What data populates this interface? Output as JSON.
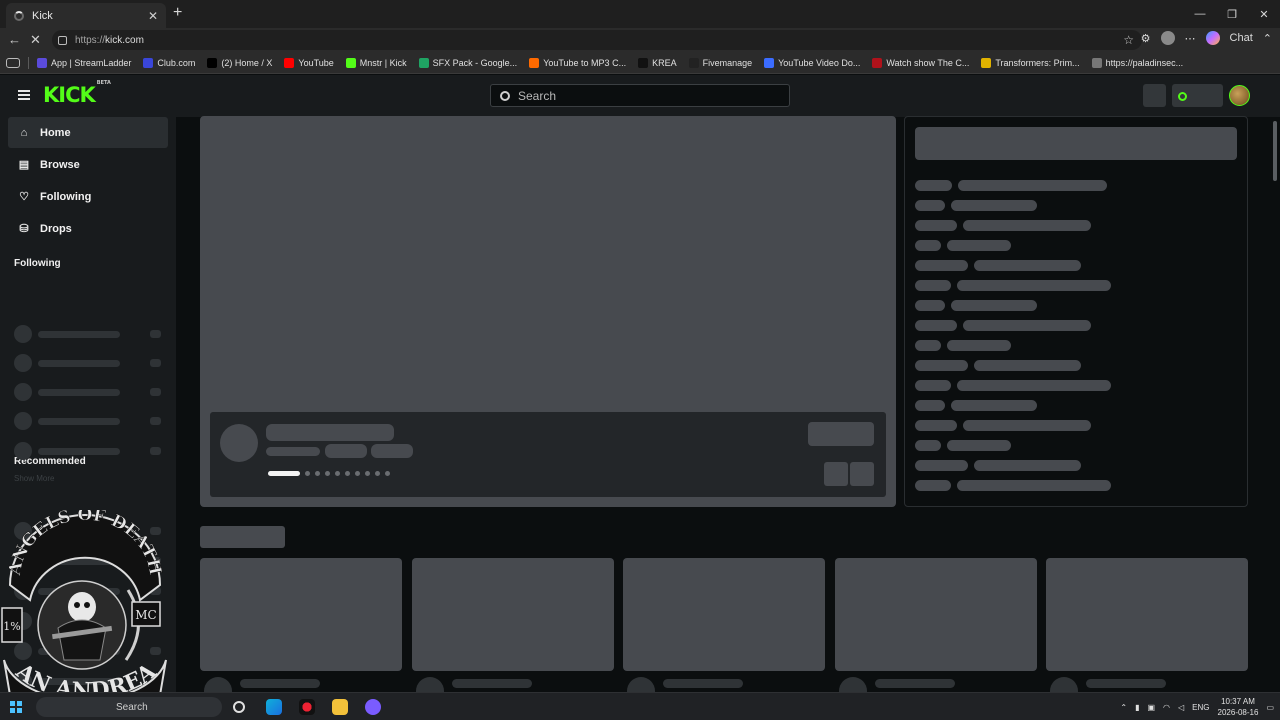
{
  "browser": {
    "tab_title": "Kick",
    "new_tab_glyph": "+",
    "url_protocol": "https://",
    "url_host": "kick.com",
    "chat_label": "Chat",
    "bookmarks": [
      {
        "label": "App | StreamLadder",
        "color": "#5b4bdb"
      },
      {
        "label": "Club.com",
        "color": "#3a46d9"
      },
      {
        "label": "(2) Home / X",
        "color": "#000000"
      },
      {
        "label": "YouTube",
        "color": "#ff0000"
      },
      {
        "label": "Mnstr | Kick",
        "color": "#53fc18"
      },
      {
        "label": "SFX Pack - Google...",
        "color": "#1fa463"
      },
      {
        "label": "YouTube to MP3 C...",
        "color": "#ff6a00"
      },
      {
        "label": "KREA",
        "color": "#111111"
      },
      {
        "label": "Fivemanage",
        "color": "#222222"
      },
      {
        "label": "YouTube Video Do...",
        "color": "#3b6cff"
      },
      {
        "label": "Watch show The C...",
        "color": "#b0121b"
      },
      {
        "label": "Transformers: Prim...",
        "color": "#e0b200"
      },
      {
        "label": "https://paladinsec...",
        "color": "#777777"
      }
    ]
  },
  "kick": {
    "logo_text": "KICK",
    "logo_badge": "BETA",
    "search_placeholder": "Search",
    "accent": "#53fc18",
    "nav": [
      {
        "label": "Home",
        "icon": "home-icon",
        "active": true
      },
      {
        "label": "Browse",
        "icon": "browse-icon",
        "active": false
      },
      {
        "label": "Following",
        "icon": "heart-icon",
        "active": false
      },
      {
        "label": "Drops",
        "icon": "drops-icon",
        "active": false
      }
    ],
    "following_heading": "Following",
    "show_more": "Show More",
    "recommended_heading": "Recommended"
  },
  "watermark": {
    "top_text": "ANGELS OF DEATH",
    "bottom_text": "SAN ANDREAS",
    "left_badge": "1%",
    "right_badge": "MC"
  },
  "taskbar": {
    "search_label": "Search",
    "language": "ENG",
    "time": "10:37 AM",
    "date": "2026-08-16"
  }
}
